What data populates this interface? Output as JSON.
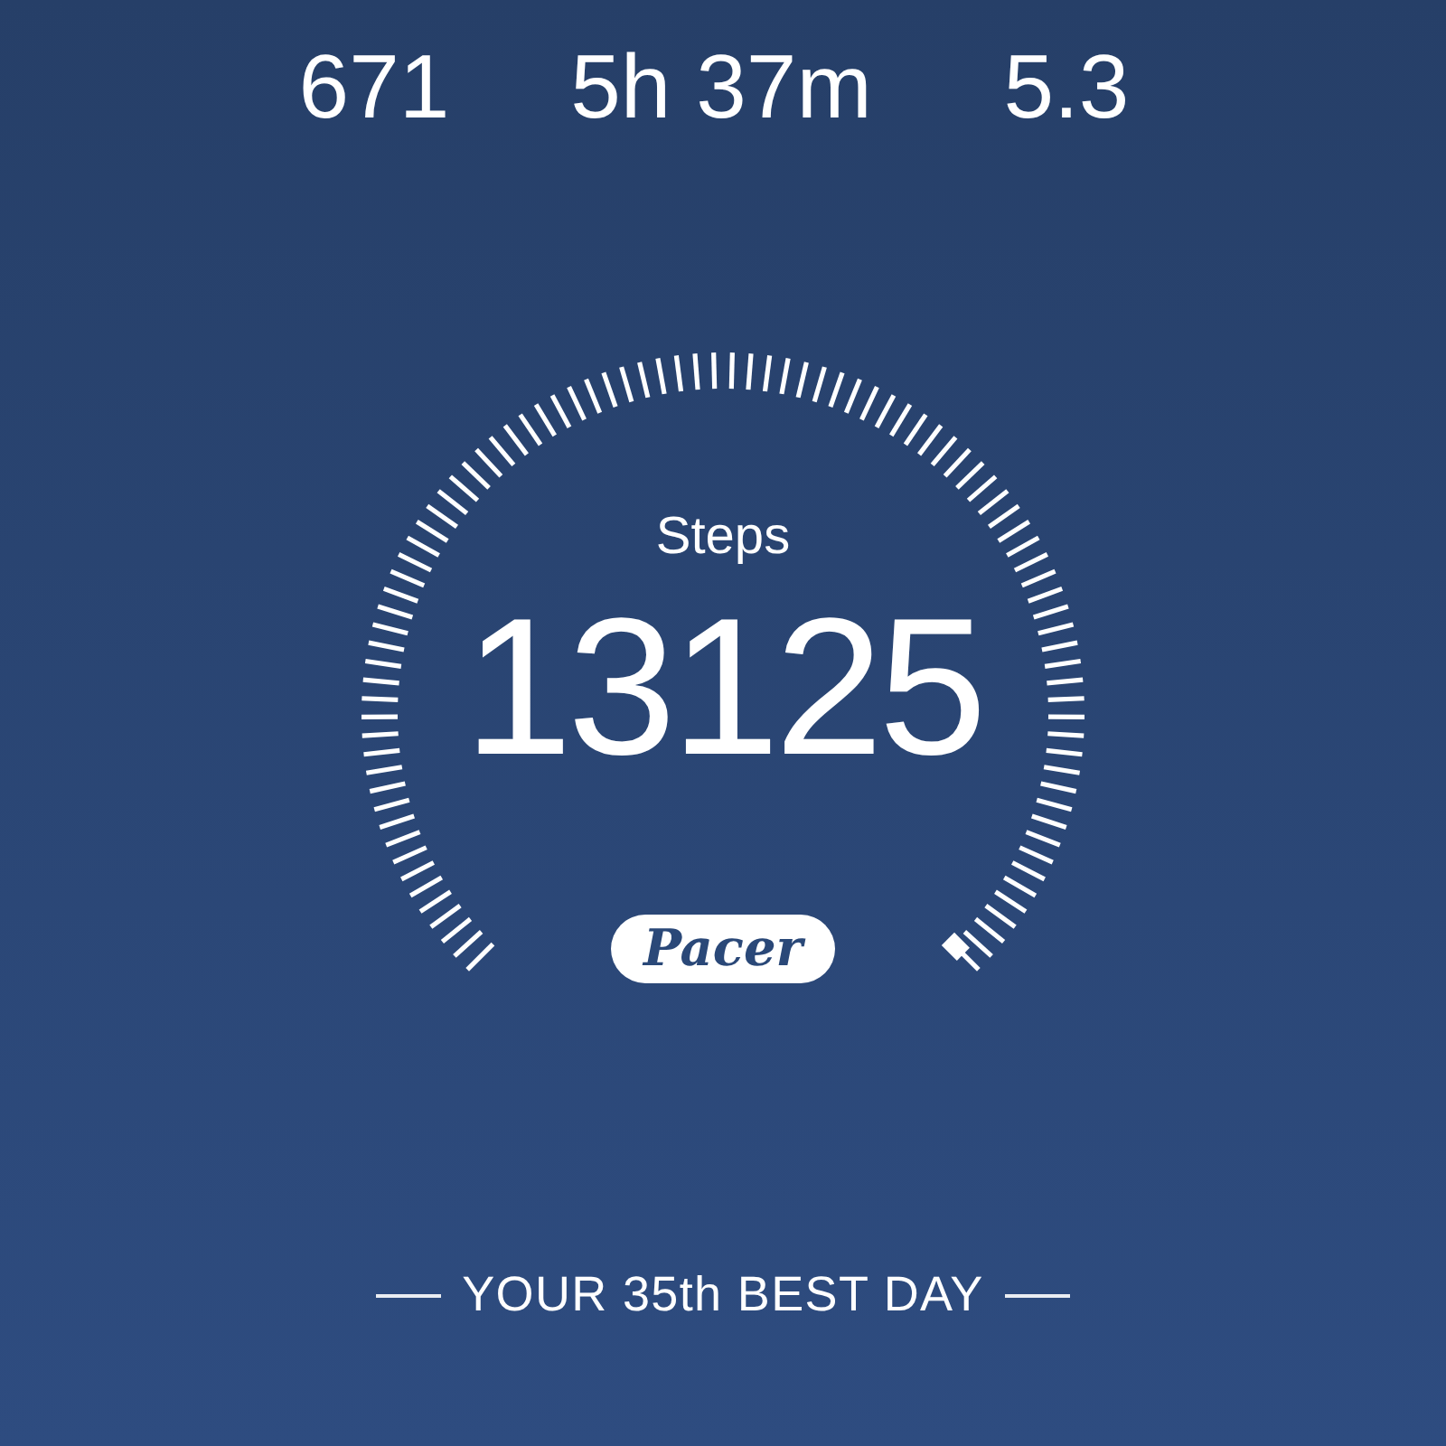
{
  "stats": [
    {
      "value": "671"
    },
    {
      "value": "5h 37m"
    },
    {
      "value": "5.3"
    }
  ],
  "steps": {
    "label": "Steps",
    "value": "13125"
  },
  "logo": {
    "text": "Pacer"
  },
  "best_day": {
    "text": "YOUR 35th BEST DAY"
  }
}
